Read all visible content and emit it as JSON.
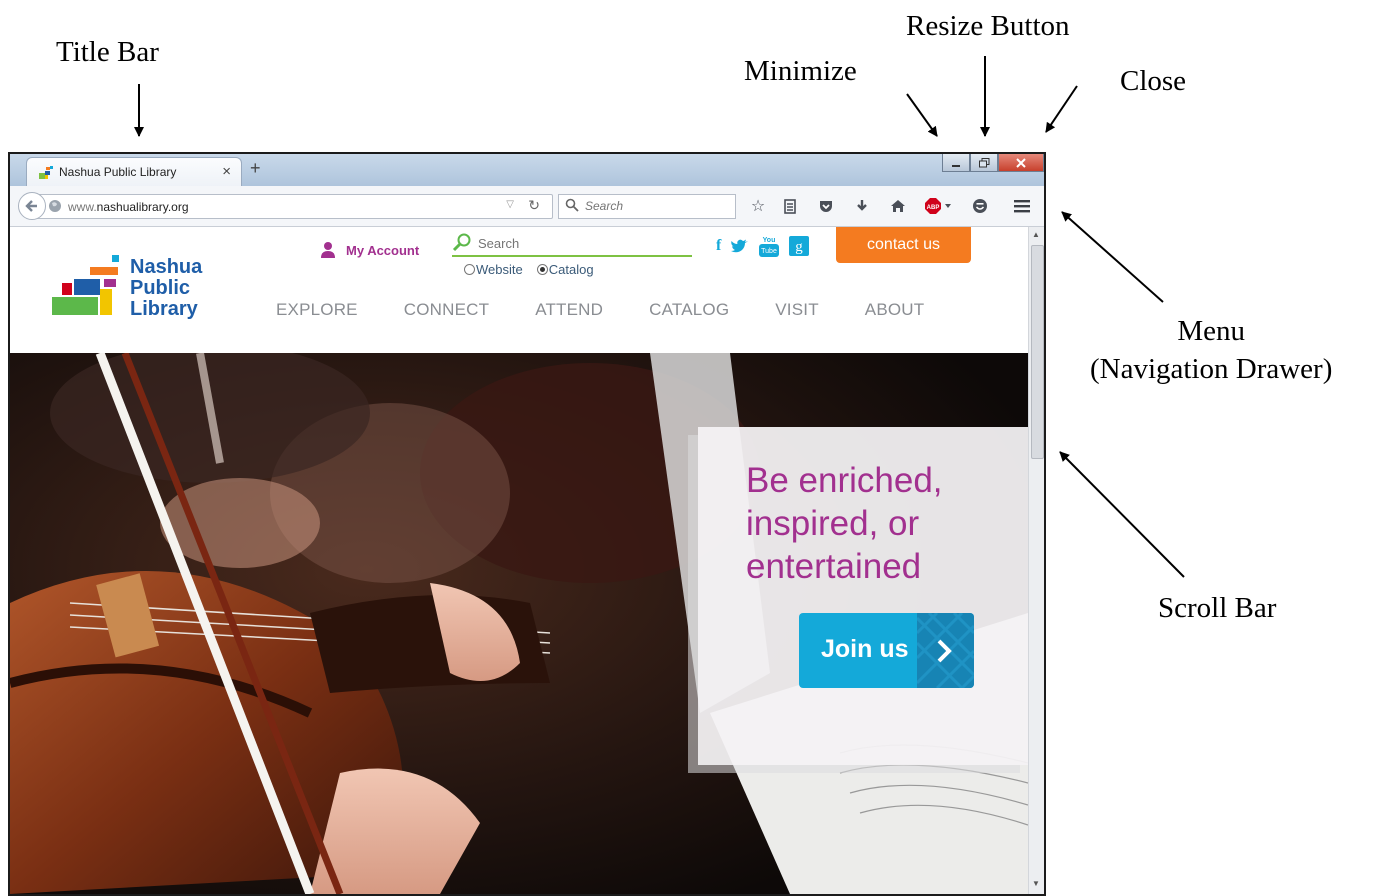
{
  "annotations": {
    "title_bar": "Title Bar",
    "minimize": "Minimize",
    "resize_button": "Resize Button",
    "close": "Close",
    "menu_line1": "Menu",
    "menu_line2": "(Navigation Drawer)",
    "scroll_bar": "Scroll Bar"
  },
  "browser": {
    "tab_title": "Nashua Public Library",
    "tab_close": "×",
    "new_tab": "+",
    "url_prefix": "www.",
    "url_domain": "nashualibrary.org",
    "search_placeholder": "Search"
  },
  "site": {
    "logo_line1": "Nashua",
    "logo_line2": "Public",
    "logo_line3": "Library",
    "my_account": "My Account",
    "search_placeholder": "Search",
    "radio_website": "Website",
    "radio_catalog": "Catalog",
    "contact_button": "contact us",
    "nav": [
      "EXPLORE",
      "CONNECT",
      "ATTEND",
      "CATALOG",
      "VISIT",
      "ABOUT"
    ],
    "hero_text": "Be enriched, inspired, or entertained",
    "join_button": "Join us"
  },
  "colors": {
    "brand_purple": "#a2308f",
    "brand_blue": "#1f5ea8",
    "contact_orange": "#f47b20",
    "join_cyan": "#14a9d9",
    "search_green": "#7ec243"
  }
}
